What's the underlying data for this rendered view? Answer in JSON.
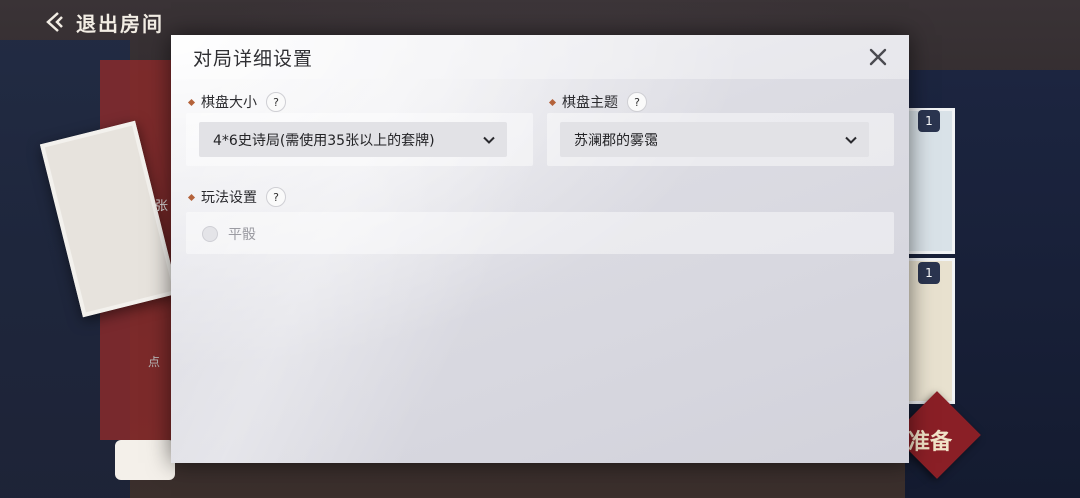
{
  "top_bar": {
    "exit_label": "退出房间",
    "exit_icon": "exit-arrow-icon"
  },
  "background": {
    "char_label": "张",
    "hint_label": "点",
    "ready_label": "准备",
    "badge_count": "1"
  },
  "modal": {
    "title": "对局详细设置",
    "close_icon": "close-icon",
    "board_size": {
      "label": "棋盘大小",
      "help": "?",
      "selected": "4*6史诗局(需使用35张以上的套牌)"
    },
    "board_theme": {
      "label": "棋盘主题",
      "help": "?",
      "selected": "苏澜郡的雾霭"
    },
    "play_settings": {
      "label": "玩法设置",
      "help": "?",
      "options": [
        {
          "label": "平骰",
          "checked": false
        }
      ]
    }
  },
  "colors": {
    "accent_diamond": "#b4623a",
    "modal_bg": "#dcdce3",
    "ready_red": "#8a1f26"
  }
}
